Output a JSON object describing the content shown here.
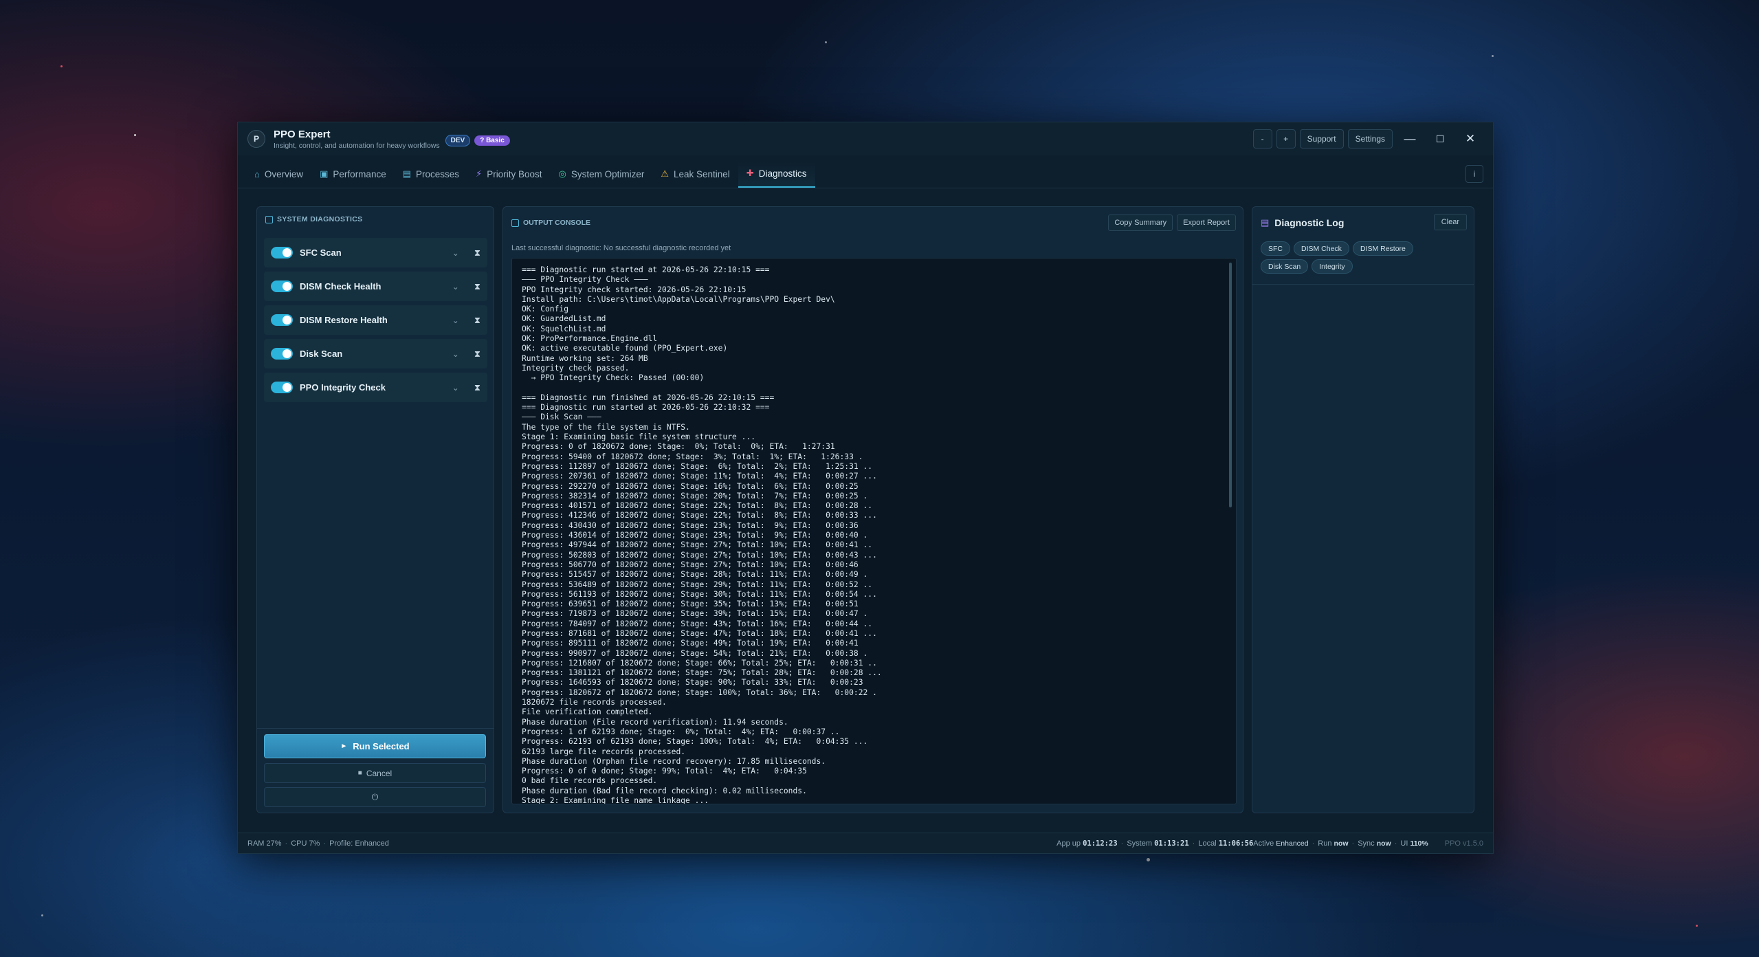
{
  "app": {
    "logo_letter": "P",
    "title": "PPO Expert",
    "subtitle": "Insight, control, and automation for heavy workflows",
    "badge_dev": "DEV",
    "badge_basic": "? Basic"
  },
  "titlebar": {
    "zoom_out": "-",
    "zoom_in": "+",
    "support": "Support",
    "settings": "Settings",
    "minimize": "—",
    "maximize": "☐",
    "close": "✕"
  },
  "tabs": [
    {
      "label": "Overview",
      "icon": "home-icon",
      "glyph": "⌂"
    },
    {
      "label": "Performance",
      "icon": "gauge-icon",
      "glyph": "▣"
    },
    {
      "label": "Processes",
      "icon": "file-icon",
      "glyph": "▤"
    },
    {
      "label": "Priority Boost",
      "icon": "bolt-icon",
      "glyph": "⚡"
    },
    {
      "label": "System Optimizer",
      "icon": "controller-icon",
      "glyph": "◎"
    },
    {
      "label": "Leak Sentinel",
      "icon": "warning-icon",
      "glyph": "⚠"
    },
    {
      "label": "Diagnostics",
      "icon": "stethoscope-icon",
      "glyph": "✚"
    }
  ],
  "tab_info": "i",
  "left": {
    "header": "SYSTEM DIAGNOSTICS",
    "items": [
      {
        "label": "SFC Scan",
        "enabled": true
      },
      {
        "label": "DISM Check Health",
        "enabled": true
      },
      {
        "label": "DISM Restore Health",
        "enabled": true
      },
      {
        "label": "Disk Scan",
        "enabled": true
      },
      {
        "label": "PPO Integrity Check",
        "enabled": true
      }
    ],
    "chevron": "⌄",
    "hourglass": "⧗",
    "run_label": "Run Selected",
    "run_glyph": "►",
    "cancel_label": "Cancel",
    "cancel_glyph": "■",
    "extra_glyph": "⏻"
  },
  "console": {
    "header": "OUTPUT CONSOLE",
    "copy_summary": "Copy Summary",
    "export_report": "Export Report",
    "last_diag": "Last successful diagnostic: No successful diagnostic recorded yet",
    "output": "=== Diagnostic run started at 2026-05-26 22:10:15 ===\n——— PPO Integrity Check ———\nPPO Integrity check started: 2026-05-26 22:10:15\nInstall path: C:\\Users\\timot\\AppData\\Local\\Programs\\PPO Expert Dev\\\nOK: Config\nOK: GuardedList.md\nOK: SquelchList.md\nOK: ProPerformance.Engine.dll\nOK: active executable found (PPO_Expert.exe)\nRuntime working set: 264 MB\nIntegrity check passed.\n  → PPO Integrity Check: Passed (00:00)\n\n=== Diagnostic run finished at 2026-05-26 22:10:15 ===\n=== Diagnostic run started at 2026-05-26 22:10:32 ===\n——— Disk Scan ———\nThe type of the file system is NTFS.\nStage 1: Examining basic file system structure ...\nProgress: 0 of 1820672 done; Stage:  0%; Total:  0%; ETA:   1:27:31\nProgress: 59400 of 1820672 done; Stage:  3%; Total:  1%; ETA:   1:26:33 .\nProgress: 112897 of 1820672 done; Stage:  6%; Total:  2%; ETA:   1:25:31 ..\nProgress: 207361 of 1820672 done; Stage: 11%; Total:  4%; ETA:   0:00:27 ...\nProgress: 292270 of 1820672 done; Stage: 16%; Total:  6%; ETA:   0:00:25\nProgress: 382314 of 1820672 done; Stage: 20%; Total:  7%; ETA:   0:00:25 .\nProgress: 401571 of 1820672 done; Stage: 22%; Total:  8%; ETA:   0:00:28 ..\nProgress: 412346 of 1820672 done; Stage: 22%; Total:  8%; ETA:   0:00:33 ...\nProgress: 430430 of 1820672 done; Stage: 23%; Total:  9%; ETA:   0:00:36\nProgress: 436014 of 1820672 done; Stage: 23%; Total:  9%; ETA:   0:00:40 .\nProgress: 497944 of 1820672 done; Stage: 27%; Total: 10%; ETA:   0:00:41 ..\nProgress: 502803 of 1820672 done; Stage: 27%; Total: 10%; ETA:   0:00:43 ...\nProgress: 506770 of 1820672 done; Stage: 27%; Total: 10%; ETA:   0:00:46\nProgress: 515457 of 1820672 done; Stage: 28%; Total: 11%; ETA:   0:00:49 .\nProgress: 536489 of 1820672 done; Stage: 29%; Total: 11%; ETA:   0:00:52 ..\nProgress: 561193 of 1820672 done; Stage: 30%; Total: 11%; ETA:   0:00:54 ...\nProgress: 639651 of 1820672 done; Stage: 35%; Total: 13%; ETA:   0:00:51\nProgress: 719873 of 1820672 done; Stage: 39%; Total: 15%; ETA:   0:00:47 .\nProgress: 784097 of 1820672 done; Stage: 43%; Total: 16%; ETA:   0:00:44 ..\nProgress: 871681 of 1820672 done; Stage: 47%; Total: 18%; ETA:   0:00:41 ...\nProgress: 895111 of 1820672 done; Stage: 49%; Total: 19%; ETA:   0:00:41\nProgress: 990977 of 1820672 done; Stage: 54%; Total: 21%; ETA:   0:00:38 .\nProgress: 1216807 of 1820672 done; Stage: 66%; Total: 25%; ETA:   0:00:31 ..\nProgress: 1381121 of 1820672 done; Stage: 75%; Total: 28%; ETA:   0:00:28 ...\nProgress: 1646593 of 1820672 done; Stage: 90%; Total: 33%; ETA:   0:00:23\nProgress: 1820672 of 1820672 done; Stage: 100%; Total: 36%; ETA:   0:00:22 .\n1820672 file records processed.\nFile verification completed.\nPhase duration (File record verification): 11.94 seconds.\nProgress: 1 of 62193 done; Stage:  0%; Total:  4%; ETA:   0:00:37 ..\nProgress: 62193 of 62193 done; Stage: 100%; Total:  4%; ETA:   0:04:35 ...\n62193 large file records processed.\nPhase duration (Orphan file record recovery): 17.85 milliseconds.\nProgress: 0 of 0 done; Stage: 99%; Total:  4%; ETA:   0:04:35\n0 bad file records processed.\nPhase duration (Bad file record checking): 0.02 milliseconds.\nStage 2: Examining file name linkage ..."
  },
  "right": {
    "title": "Diagnostic Log",
    "clear": "Clear",
    "chips": [
      "SFC",
      "DISM Check",
      "DISM Restore",
      "Disk Scan",
      "Integrity"
    ]
  },
  "status": {
    "ram": "RAM 27%",
    "cpu": "CPU 7%",
    "profile": "Profile: Enhanced",
    "sep": "·",
    "app_up_label": "App up",
    "app_up": "01:12:23",
    "system_label": "System",
    "system": "01:13:21",
    "local_label": "Local",
    "local": "11:06:56",
    "active_label": "Active",
    "active": "Enhanced",
    "run_label": "Run",
    "run": "now",
    "sync_label": "Sync",
    "sync": "now",
    "ui_label": "UI",
    "ui": "110%",
    "version": "PPO v1.5.0"
  },
  "colors": {
    "accent": "#3bb6da",
    "badge_basic": "#7a57d6",
    "badge_dev": "#1a3d6b"
  }
}
